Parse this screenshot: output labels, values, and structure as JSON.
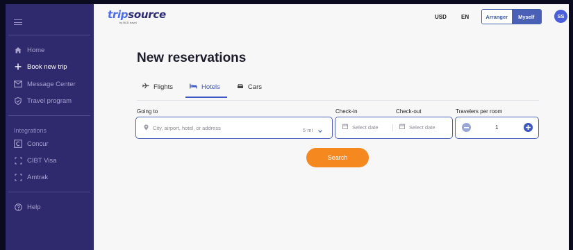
{
  "sidebar": {
    "items": [
      {
        "label": "Home",
        "icon": "home-icon"
      },
      {
        "label": "Book new trip",
        "icon": "plus-icon"
      },
      {
        "label": "Message Center",
        "icon": "mail-icon"
      },
      {
        "label": "Travel program",
        "icon": "shield-icon"
      }
    ],
    "integrations_label": "Integrations",
    "integrations": [
      {
        "label": "Concur",
        "icon": "concur-icon"
      },
      {
        "label": "CIBT Visa",
        "icon": "bracket-icon"
      },
      {
        "label": "Amtrak",
        "icon": "bracket-icon"
      }
    ],
    "help": {
      "label": "Help",
      "icon": "help-icon"
    }
  },
  "header": {
    "logo_trip": "trip",
    "logo_source": "source",
    "logo_sub": "by BCD travel",
    "currency": "USD",
    "language": "EN",
    "role_toggle": {
      "arranger": "Arranger",
      "myself": "Myself",
      "selected": "Myself"
    },
    "avatar_initials": "SS"
  },
  "main": {
    "title": "New reservations",
    "tabs": [
      {
        "label": "Flights",
        "icon": "plane-icon",
        "active": false
      },
      {
        "label": "Hotels",
        "icon": "bed-icon",
        "active": true
      },
      {
        "label": "Cars",
        "icon": "car-icon",
        "active": false
      }
    ],
    "form": {
      "going_to_label": "Going to",
      "going_to_placeholder": "City, airport, hotel, or address",
      "radius": "5 mi",
      "checkin_label": "Check-in",
      "checkin_placeholder": "Select date",
      "checkout_label": "Check-out",
      "checkout_placeholder": "Select date",
      "travelers_label": "Travelers per room",
      "travelers_value": "1"
    },
    "search_label": "Search"
  },
  "colors": {
    "sidebar_bg": "#2e2a6d",
    "accent": "#3b57c4",
    "search_button": "#f5891f"
  }
}
